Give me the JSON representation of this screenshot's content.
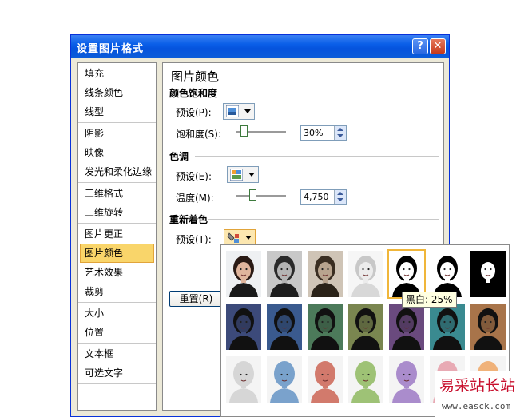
{
  "dialog": {
    "title": "设置图片格式",
    "help_glyph": "?",
    "close_glyph": "✕"
  },
  "sidebar": {
    "groups": [
      [
        "填充",
        "线条颜色",
        "线型"
      ],
      [
        "阴影",
        "映像",
        "发光和柔化边缘"
      ],
      [
        "三维格式",
        "三维旋转"
      ],
      [
        "图片更正",
        "图片颜色",
        "艺术效果",
        "裁剪"
      ],
      [
        "大小",
        "位置"
      ],
      [
        "文本框",
        "可选文字"
      ]
    ],
    "active": "图片颜色"
  },
  "panel": {
    "title": "图片颜色",
    "saturation": {
      "heading": "颜色饱和度",
      "preset_label": "预设(P):",
      "value_label": "饱和度(S):",
      "value": "30%",
      "level_fraction": 0.09
    },
    "tone": {
      "heading": "色调",
      "preset_label": "预设(E):",
      "value_label": "温度(M):",
      "value": "4,750",
      "level_fraction": 0.3
    },
    "recolor": {
      "heading": "重新着色",
      "preset_label": "预设(T):"
    },
    "reset_label": "重置(R)"
  },
  "gallery": {
    "tooltip": "黑白: 25%",
    "selected_index": 4,
    "rows": [
      [
        "color",
        "grayscale",
        "sepia",
        "washout",
        "bw25",
        "bw50",
        "bw75"
      ],
      [
        "dark-blue",
        "dark-steel",
        "dark-green",
        "dark-olive",
        "dark-purple",
        "dark-teal",
        "dark-orange"
      ],
      [
        "light-gray",
        "light-blue",
        "light-red",
        "light-green",
        "light-purple",
        "light-pink",
        "light-orange"
      ]
    ],
    "colors": {
      "color": "#c9a088",
      "grayscale": "#9a9a9a",
      "sepia": "#9a8a78",
      "washout": "#e6e6e6",
      "dark-blue": "#3c4a7a",
      "dark-steel": "#3a5a8e",
      "dark-green": "#4c7a5a",
      "dark-olive": "#7a8650",
      "dark-purple": "#6a4a7e",
      "dark-teal": "#3a8a90",
      "dark-orange": "#a8744a",
      "light-gray": "#d6d6d6",
      "light-blue": "#7aa2cc",
      "light-red": "#d27a6c",
      "light-green": "#9ec276",
      "light-purple": "#aa8ccc",
      "light-pink": "#e8aab4",
      "light-orange": "#f0b27a"
    }
  },
  "watermark": {
    "logo": "易采站长站",
    "url": "www.easck.com"
  }
}
